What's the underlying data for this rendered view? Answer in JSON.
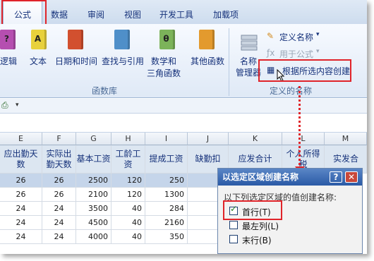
{
  "tabs": [
    "公式",
    "数据",
    "审阅",
    "视图",
    "开发工具",
    "加载项"
  ],
  "ribbon": {
    "buttons": [
      {
        "label": "逻辑",
        "icon": "logic-book-icon",
        "glyph": "?",
        "color": "#b54fb0"
      },
      {
        "label": "文本",
        "icon": "text-book-icon",
        "glyph": "A",
        "color": "#e8d13c"
      },
      {
        "label": "日期和时间",
        "icon": "datetime-book-icon",
        "glyph": "",
        "color": "#d2502f"
      },
      {
        "label": "查找与引用",
        "icon": "lookup-book-icon",
        "glyph": "",
        "color": "#4f8fc9"
      },
      {
        "label": "数学和",
        "label2": "三角函数",
        "icon": "math-book-icon",
        "glyph": "θ",
        "color": "#7cb35a"
      },
      {
        "label": "其他函数",
        "icon": "more-functions-book-icon",
        "glyph": "",
        "color": "#e39a2e"
      }
    ],
    "group_library": "函数库",
    "name_manager": {
      "line1": "名称",
      "line2": "管理器"
    },
    "define_name": "定义名称",
    "use_in_formula": "用于公式",
    "create_from_selection": "根据所选内容创建",
    "group_defined_names": "定义的名称"
  },
  "columns": [
    "E",
    "F",
    "G",
    "H",
    "I",
    "J",
    "K",
    "L",
    "M"
  ],
  "headers": [
    "应出勤天数",
    "实际出勤天数",
    "基本工资",
    "工龄工资",
    "提成工资",
    "缺勤扣",
    "应发合计",
    "个人所得税",
    "实发合"
  ],
  "rows": [
    [
      "26",
      "26",
      "2500",
      "120",
      "250"
    ],
    [
      "26",
      "26",
      "2100",
      "120",
      "1300"
    ],
    [
      "24",
      "24",
      "3500",
      "40",
      "284"
    ],
    [
      "24",
      "24",
      "4500",
      "40",
      "2160"
    ],
    [
      "24",
      "24",
      "4000",
      "40",
      "350"
    ]
  ],
  "dialog": {
    "title": "以选定区域创建名称",
    "help": "?",
    "close": "✕",
    "prompt": "以下列选定区域的值创建名称:",
    "options": [
      {
        "label": "首行(T)",
        "checked": true
      },
      {
        "label": "最左列(L)",
        "checked": false
      },
      {
        "label": "末行(B)",
        "checked": false
      }
    ]
  }
}
